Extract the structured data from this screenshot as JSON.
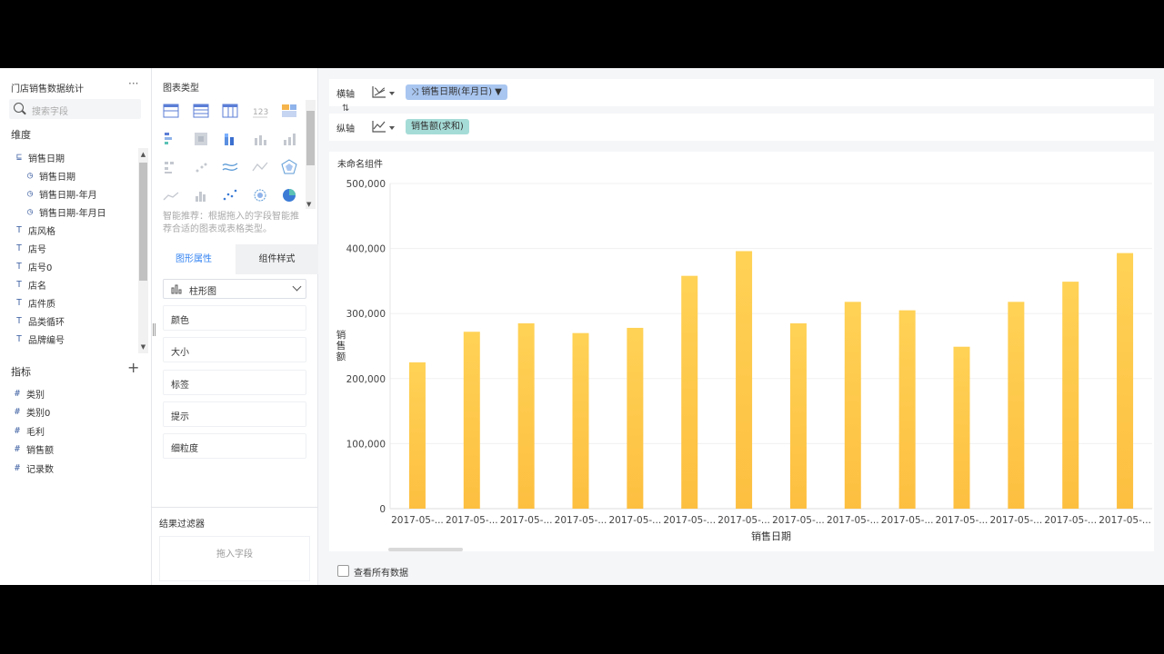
{
  "left_panel": {
    "dataset_title": "门店销售数据统计",
    "more_label": "···",
    "search_placeholder": "搜索字段",
    "dimensions_label": "维度",
    "dimension_fields": [
      {
        "label": "销售日期",
        "icon": "date-group-icon",
        "glyph": "⊑",
        "indent": 0
      },
      {
        "label": "销售日期",
        "icon": "clock-icon",
        "glyph": "◷",
        "indent": 1
      },
      {
        "label": "销售日期-年月",
        "icon": "clock-icon",
        "glyph": "◷",
        "indent": 1
      },
      {
        "label": "销售日期-年月日",
        "icon": "clock-icon",
        "glyph": "◷",
        "indent": 1
      },
      {
        "label": "店风格",
        "icon": "text-field-icon",
        "glyph": "T",
        "indent": 0
      },
      {
        "label": "店号",
        "icon": "text-field-icon",
        "glyph": "T",
        "indent": 0
      },
      {
        "label": "店号0",
        "icon": "text-field-icon",
        "glyph": "T",
        "indent": 0
      },
      {
        "label": "店名",
        "icon": "text-field-icon",
        "glyph": "T",
        "indent": 0
      },
      {
        "label": "店件质",
        "icon": "text-field-icon",
        "glyph": "T",
        "indent": 0
      },
      {
        "label": "品类循环",
        "icon": "text-field-icon",
        "glyph": "T",
        "indent": 0
      },
      {
        "label": "品牌编号",
        "icon": "text-field-icon",
        "glyph": "T",
        "indent": 0
      }
    ],
    "measures_label": "指标",
    "add_label": "+",
    "measure_fields": [
      {
        "label": "类别",
        "glyph": "#"
      },
      {
        "label": "类别0",
        "glyph": "#"
      },
      {
        "label": "毛利",
        "glyph": "#"
      },
      {
        "label": "销售额",
        "glyph": "#"
      },
      {
        "label": "记录数",
        "glyph": "#"
      }
    ]
  },
  "mid_panel": {
    "chart_types_title": "图表类型",
    "smart_tip": "智能推荐：根据拖入的字段智能推荐合适的图表或表格类型。",
    "tabs": {
      "active": "图形属性",
      "other": "组件样式"
    },
    "chart_select_label": "柱形图",
    "props": [
      "颜色",
      "大小",
      "标签",
      "提示",
      "细粒度"
    ],
    "filter_title": "结果过滤器",
    "filter_placeholder": "拖入字段"
  },
  "axes": {
    "x_label": "横轴",
    "y_label": "纵轴",
    "x_pill": "销售日期(年月日)",
    "y_pill": "销售额(求和)"
  },
  "chart_card": {
    "title": "未命名组件",
    "show_all_label": "查看所有数据"
  },
  "colors": {
    "bar_top": "#ffd256",
    "bar_bottom": "#fdbf40",
    "accent": "#3685f2",
    "x_pill": "#a9c6f0",
    "y_pill": "#a6dcd8"
  },
  "chart_data": {
    "type": "bar",
    "xlabel": "销售日期",
    "ylabel": "销售额",
    "ylim": [
      0,
      500000
    ],
    "y_ticks": [
      "0",
      "100,000",
      "200,000",
      "300,000",
      "400,000",
      "500,000"
    ],
    "y_tick_values": [
      0,
      100000,
      200000,
      300000,
      400000,
      500000
    ],
    "grid": true,
    "categories": [
      "2017-05-...",
      "2017-05-...",
      "2017-05-...",
      "2017-05-...",
      "2017-05-...",
      "2017-05-...",
      "2017-05-...",
      "2017-05-...",
      "2017-05-...",
      "2017-05-...",
      "2017-05-...",
      "2017-05-...",
      "2017-05-...",
      "2017-05-..."
    ],
    "values": [
      225000,
      272000,
      285000,
      270000,
      278000,
      358000,
      396000,
      285000,
      318000,
      305000,
      249000,
      318000,
      349000,
      393000
    ]
  }
}
